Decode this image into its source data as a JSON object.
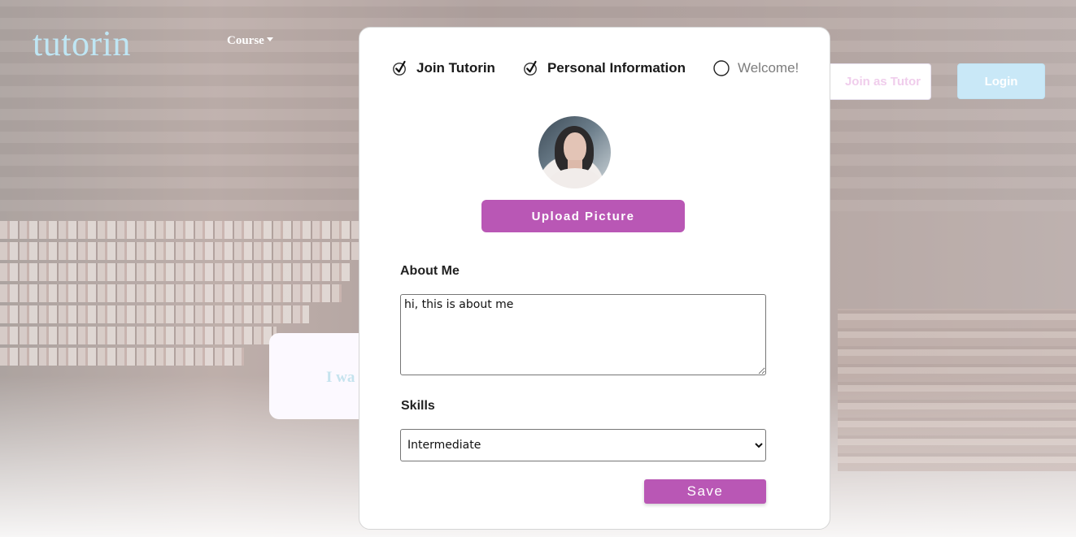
{
  "nav": {
    "logo": "tutorin",
    "course_label": "Course",
    "join_tutor_label": "Join as Tutor",
    "login_label": "Login"
  },
  "hero": {
    "card_text_fragment": "I wa"
  },
  "modal": {
    "steps": [
      {
        "label": "Join Tutorin",
        "state": "checked"
      },
      {
        "label": "Personal Information",
        "state": "checked"
      },
      {
        "label": "Welcome!",
        "state": "unchecked"
      }
    ],
    "upload_label": "Upload Picture",
    "about_label": "About Me",
    "about_value": "hi, this is about me",
    "skills_label": "Skills",
    "skills_selected": "Intermediate",
    "save_label": "Save"
  },
  "colors": {
    "accent": "#b957b5",
    "logo": "#bfe6f4",
    "login_bg": "#c9e8f7"
  },
  "icons": {
    "step_checked": "checkbox-checked-icon",
    "step_unchecked": "radio-circle-icon",
    "course_caret": "chevron-down-icon"
  }
}
